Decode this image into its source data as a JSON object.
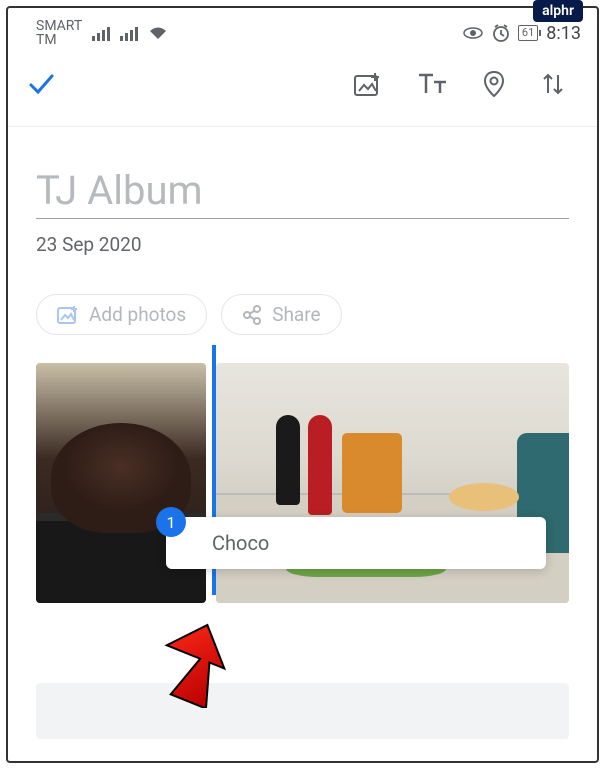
{
  "watermark": "alphr",
  "status": {
    "carrier_line1": "SMART",
    "carrier_line2": "TM",
    "battery": "61",
    "time": "8:13"
  },
  "album": {
    "title": "TJ Album",
    "date": "23 Sep 2020"
  },
  "actions": {
    "add_photos": "Add photos",
    "share": "Share"
  },
  "clipboard": {
    "count": "1",
    "label": "Choco"
  }
}
